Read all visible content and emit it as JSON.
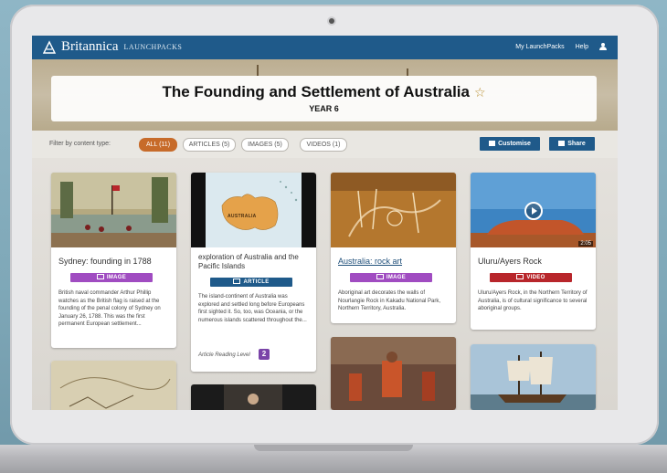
{
  "nav": {
    "brand": "Britannica",
    "brand_sub": "LaunchPacks",
    "my_launchpacks": "My LaunchPacks",
    "help": "Help",
    "user_icon": "user-icon"
  },
  "hero": {
    "title": "The Founding and Settlement of Australia",
    "star_icon": "star-outline-icon",
    "star_glyph": "☆",
    "subtitle": "YEAR 6"
  },
  "filter": {
    "label": "Filter by content type:",
    "chips": [
      "ALL (11)",
      "ARTICLES (5)",
      "IMAGES (5)",
      "VIDEOS (1)"
    ],
    "active": "ALL (11)",
    "customise": "Customise",
    "share": "Share"
  },
  "cards": [
    {
      "title": "Sydney: founding in 1788",
      "type": "IMAGE",
      "description": "British naval commander Arthur Phillip watches as the British flag is raised at the founding of the penal colony of Sydney on January 26, 1788. This was the first permanent European settlement..."
    },
    {
      "title": "exploration of Australia and the Pacific Islands",
      "type": "ARTICLE",
      "description": "The island-continent of Australia was explored and settled long before Europeans first sighted it. So, too, was Oceania, or the numerous islands scattered throughout the...",
      "map_label": "AUSTRALIA",
      "reading_label": "Article Reading Level",
      "reading_level": "2"
    },
    {
      "title": "Australia: rock art",
      "type": "IMAGE",
      "description": "Aboriginal art decorates the walls of Nourlangie Rock in Kakadu National Park, Northern Territory, Australia."
    },
    {
      "title": "Uluru/Ayers Rock",
      "type": "VIDEO",
      "duration": "2:05",
      "description": "Uluru/Ayers Rock, in the Northern Territory of Australia, is of cultural significance to several aboriginal groups."
    }
  ],
  "colors": {
    "nav": "#1f5a8a",
    "active_chip": "#c76b2a",
    "image_badge": "#a04cc1",
    "article_badge": "#1f5a8a",
    "video_badge": "#b8262b"
  }
}
